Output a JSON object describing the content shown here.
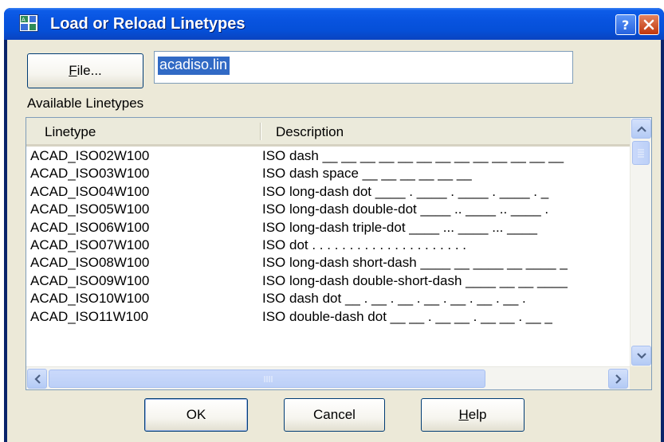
{
  "window": {
    "title": "Load or Reload Linetypes"
  },
  "file": {
    "button_label_underlined": "F",
    "button_label_rest": "ile...",
    "value": "acadiso.lin"
  },
  "available_label": "Available Linetypes",
  "list": {
    "columns": [
      "Linetype",
      "Description"
    ],
    "rows": [
      {
        "linetype": "ACAD_ISO02W100",
        "description": "ISO dash __ __ __ __ __ __ __ __ __ __ __ __ __"
      },
      {
        "linetype": "ACAD_ISO03W100",
        "description": "ISO dash space __    __    __    __    __    __"
      },
      {
        "linetype": "ACAD_ISO04W100",
        "description": "ISO long-dash dot ____ . ____ . ____ . ____ . _"
      },
      {
        "linetype": "ACAD_ISO05W100",
        "description": "ISO long-dash double-dot ____ .. ____ .. ____ ."
      },
      {
        "linetype": "ACAD_ISO06W100",
        "description": "ISO long-dash triple-dot ____ ... ____ ... ____"
      },
      {
        "linetype": "ACAD_ISO07W100",
        "description": "ISO dot . . . . . . . . . . . . . . . . . . . . ."
      },
      {
        "linetype": "ACAD_ISO08W100",
        "description": "ISO long-dash short-dash ____ __ ____ __ ____ _"
      },
      {
        "linetype": "ACAD_ISO09W100",
        "description": "ISO long-dash double-short-dash ____ __ __ ____"
      },
      {
        "linetype": "ACAD_ISO10W100",
        "description": "ISO dash dot __ . __ . __ . __ . __ . __ . __ ."
      },
      {
        "linetype": "ACAD_ISO11W100",
        "description": "ISO double-dash dot __ __ . __ __ . __ __ . __ _"
      }
    ]
  },
  "buttons": {
    "ok": "OK",
    "cancel": "Cancel",
    "help_underlined": "H",
    "help_rest": "elp"
  },
  "icons": {
    "app": "autocad-app-icon",
    "help": "question-mark-icon",
    "close": "close-x-icon",
    "scroll_up": "chevron-up-icon",
    "scroll_down": "chevron-down-icon",
    "scroll_left": "chevron-left-icon",
    "scroll_right": "chevron-right-icon"
  },
  "colors": {
    "titlebar": "#0853df",
    "dialog_bg": "#ece9d8",
    "selection": "#316ac5",
    "close_button": "#c1360b"
  }
}
